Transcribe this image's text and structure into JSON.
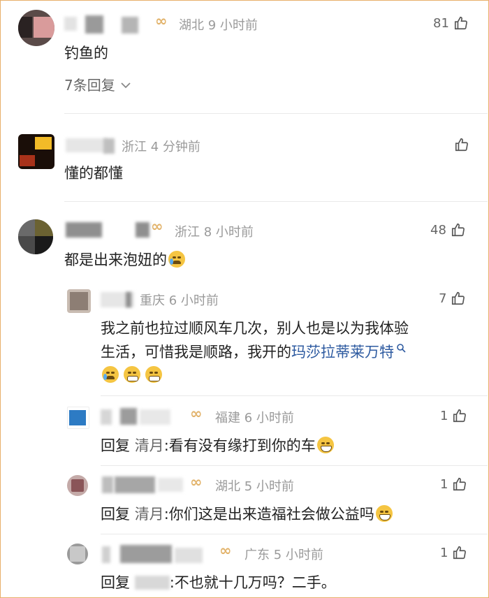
{
  "colors": {
    "accent": "#e2b36b",
    "meta": "#9a9a9a",
    "link": "#2d5aa0",
    "text": "#222222"
  },
  "badge_glyph": "∞",
  "comments": [
    {
      "location": "湖北",
      "time": "9 小时前",
      "text": "钓鱼的",
      "likes": "81",
      "replies_label": "7条回复"
    },
    {
      "location": "浙江",
      "time": "4 分钟前",
      "text": "懂的都懂",
      "likes": ""
    },
    {
      "location": "浙江",
      "time": "8 小时前",
      "text": "都是出来泡妞的",
      "likes": "48"
    }
  ],
  "replies": [
    {
      "location": "重庆",
      "time": "6 小时前",
      "likes": "7",
      "text_line1": "我之前也拉过顺风车几次，别人也是以为我体验",
      "text_line2_pre": "生活，可惜我是顺路，我开的",
      "text_link": "玛莎拉蒂莱万特",
      "search_icon": "search-icon"
    },
    {
      "location": "福建",
      "time": "6 小时前",
      "likes": "1",
      "reply_prefix": "回复",
      "reply_to": "清月",
      "text": ":看有没有缘打到你的车"
    },
    {
      "location": "湖北",
      "time": "5 小时前",
      "likes": "1",
      "reply_prefix": "回复",
      "reply_to": "清月",
      "text": ":你们这是出来造福社会做公益吗"
    },
    {
      "location": "广东",
      "time": "5 小时前",
      "likes": "1",
      "reply_prefix": "回复",
      "reply_to": "",
      "text": ":不也就十几万吗？二手。"
    }
  ]
}
